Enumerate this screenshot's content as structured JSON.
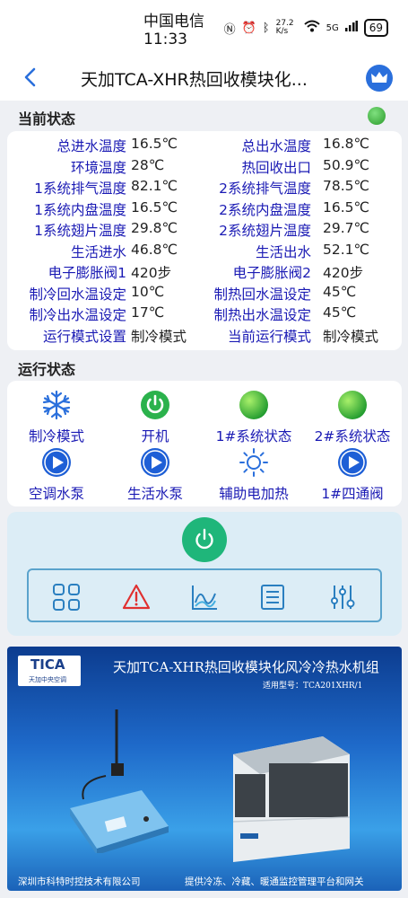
{
  "statusbar": {
    "carrier_time": "中国电信 11:33",
    "net_speed": "27.2 K/s",
    "signal": "5G",
    "battery": "69"
  },
  "header": {
    "title": "天加TCA-XHR热回收模块化..."
  },
  "current_status": {
    "section_title": "当前状态",
    "indicator_color": "#3cb83c",
    "rows": [
      {
        "l1": "总进水温度",
        "v1": "16.5℃",
        "l2": "总出水温度",
        "v2": "16.8℃"
      },
      {
        "l1": "环境温度",
        "v1": "28℃",
        "l2": "热回收出口",
        "v2": "50.9℃"
      },
      {
        "l1": "1系统排气温度",
        "v1": "82.1℃",
        "l2": "2系统排气温度",
        "v2": "78.5℃"
      },
      {
        "l1": "1系统内盘温度",
        "v1": "16.5℃",
        "l2": "2系统内盘温度",
        "v2": "16.5℃"
      },
      {
        "l1": "1系统翅片温度",
        "v1": "29.8℃",
        "l2": "2系统翅片温度",
        "v2": "29.7℃"
      },
      {
        "l1": "生活进水",
        "v1": "46.8℃",
        "l2": "生活出水",
        "v2": "52.1℃"
      },
      {
        "l1": "电子膨胀阀1",
        "v1": "420步",
        "l2": "电子膨胀阀2",
        "v2": "420步"
      },
      {
        "l1": "制冷回水温设定",
        "v1": "10℃",
        "l2": "制热回水温设定",
        "v2": "45℃"
      },
      {
        "l1": "制冷出水温设定",
        "v1": "17℃",
        "l2": "制热出水温设定",
        "v2": "45℃"
      },
      {
        "l1": "运行模式设置",
        "v1": "制冷模式",
        "l2": "当前运行模式",
        "v2": "制冷模式"
      }
    ]
  },
  "run_status": {
    "section_title": "运行状态",
    "items": [
      {
        "label": "制冷模式",
        "icon": "snowflake-icon"
      },
      {
        "label": "开机",
        "icon": "power-on-icon"
      },
      {
        "label": "1#系统状态",
        "icon": "status-dot-icon"
      },
      {
        "label": "2#系统状态",
        "icon": "status-dot-icon"
      },
      {
        "label": "空调水泵",
        "icon": "play-icon"
      },
      {
        "label": "生活水泵",
        "icon": "play-icon"
      },
      {
        "label": "辅助电加热",
        "icon": "sun-icon"
      },
      {
        "label": "1#四通阀",
        "icon": "play-icon"
      }
    ]
  },
  "toolbar": {
    "items": [
      "grid-icon",
      "warning-icon",
      "chart-icon",
      "list-icon",
      "settings-sliders-icon"
    ]
  },
  "banner": {
    "logo": "TICA",
    "logo_sub": "天加中央空调",
    "title": "天加TCA-XHR热回收模块化风冷冷热水机组",
    "model": "适用型号：TCA201XHR/1",
    "footer_left": "深圳市科特时控技术有限公司",
    "footer_right": "提供冷冻、冷藏、暖通监控管理平台和网关"
  }
}
